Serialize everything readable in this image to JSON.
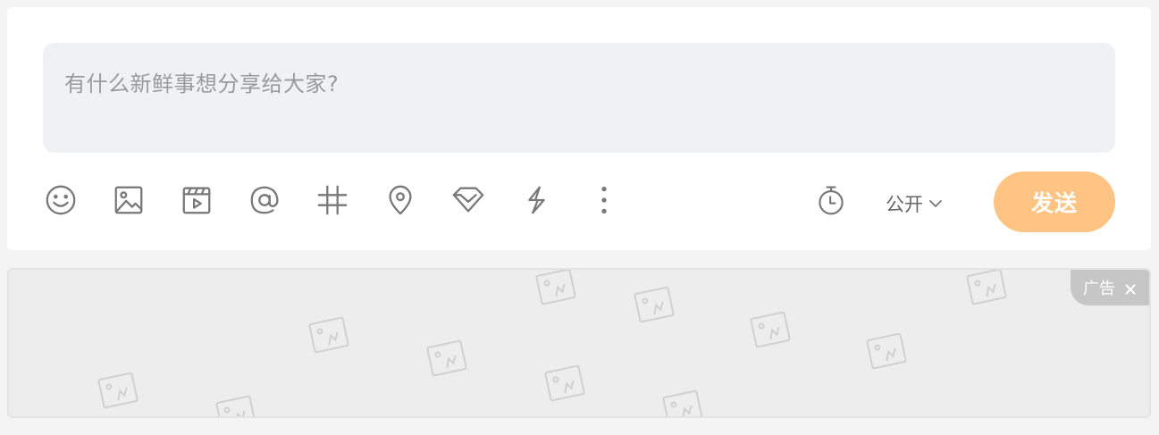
{
  "composer": {
    "placeholder": "有什么新鲜事想分享给大家?",
    "tools": [
      {
        "icon": "emoji-icon"
      },
      {
        "icon": "image-icon"
      },
      {
        "icon": "video-icon"
      },
      {
        "icon": "mention-icon"
      },
      {
        "icon": "hashtag-icon"
      },
      {
        "icon": "location-icon"
      },
      {
        "icon": "diamond-icon"
      },
      {
        "icon": "lightning-icon"
      },
      {
        "icon": "more-icon"
      }
    ],
    "schedule_icon": "timer-icon",
    "visibility_label": "公开",
    "send_label": "发送",
    "colors": {
      "send_button": "#ffc384",
      "input_bg": "#f0f1f5"
    }
  },
  "ad": {
    "badge_label": "广告",
    "close_icon": "close-icon"
  }
}
